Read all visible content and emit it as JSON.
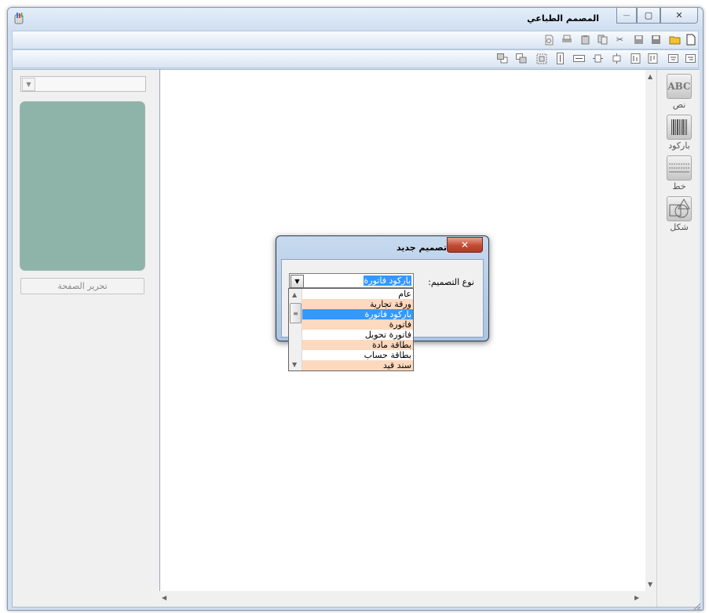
{
  "window": {
    "title": "المصمم الطباعي",
    "minimize_glyph": "—",
    "restore_glyph": "▢",
    "close_glyph": "✕"
  },
  "left_panel": {
    "combo_value": "",
    "edit_page_button": "تحرير الصفحة",
    "preview_color": "#8eb3a9"
  },
  "tools": [
    {
      "label": "نص",
      "icon": "text-abc-icon",
      "glyph": "ABC"
    },
    {
      "label": "باركود",
      "icon": "barcode-icon"
    },
    {
      "label": "خط",
      "icon": "line-icon"
    },
    {
      "label": "شكل",
      "icon": "shape-icon"
    }
  ],
  "dialog": {
    "title": "تصميم جديد",
    "close_glyph": "✕",
    "field_label": "نوع التصميم:",
    "selected_value": "باركود فاتورة",
    "options": [
      "عام",
      "ورقة تجارية",
      "باركود فاتورة",
      "فاتورة",
      "فاتورة تحويل",
      "بطاقة مادة",
      "بطاقة حساب",
      "سند قيد"
    ],
    "selected_index": 2
  },
  "colors": {
    "selection": "#3399ff",
    "alt_row": "#fdd9bf",
    "close_button": "#c24a33"
  }
}
